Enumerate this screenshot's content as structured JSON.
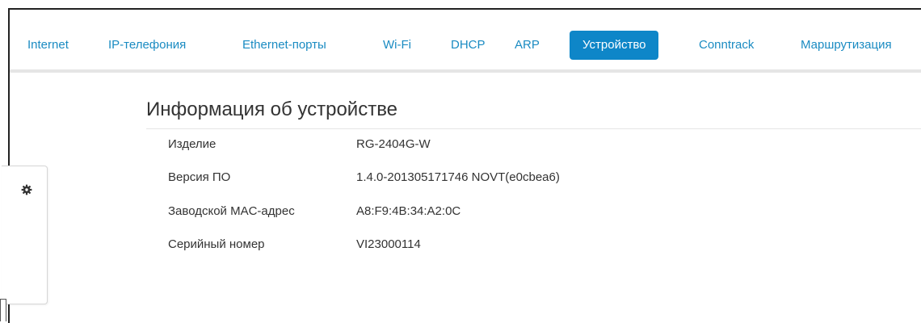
{
  "nav": {
    "tabs": [
      {
        "label": "Internet"
      },
      {
        "label": "IP-телефония"
      },
      {
        "label": "Ethernet-порты"
      },
      {
        "label": "Wi-Fi"
      },
      {
        "label": "DHCP"
      },
      {
        "label": "ARP"
      },
      {
        "label": "Устройство",
        "active": true
      },
      {
        "label": "Conntrack"
      },
      {
        "label": "Маршрутизация"
      }
    ],
    "active_color": "#0e86c8",
    "link_color": "#1a8bc2"
  },
  "side_panel": {
    "icon": "gear-icon"
  },
  "device_info": {
    "title": "Информация об устройстве",
    "rows": [
      {
        "label": "Изделие",
        "value": "RG-2404G-W"
      },
      {
        "label": "Версия ПО",
        "value": "1.4.0-201305171746 NOVT(e0cbea6)"
      },
      {
        "label": "Заводской MAC-адрес",
        "value": "A8:F9:4B:34:A2:0C"
      },
      {
        "label": "Серийный номер",
        "value": "VI23000114"
      }
    ]
  }
}
